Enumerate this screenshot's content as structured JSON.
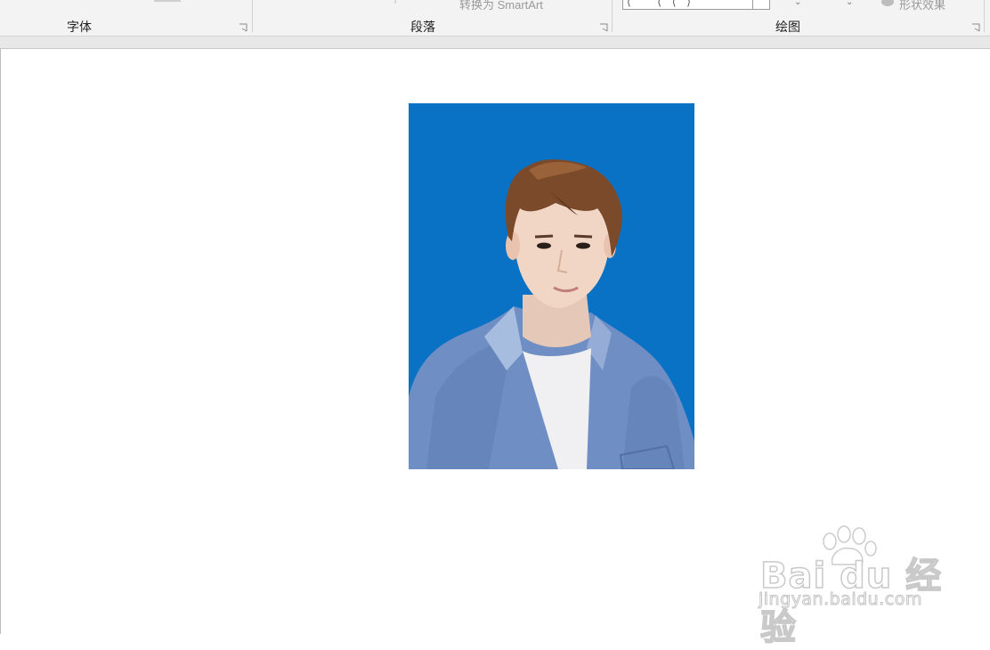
{
  "ribbon": {
    "groups": [
      {
        "label": "字体"
      },
      {
        "label": "段落",
        "ghost_command": "转换为 SmartArt"
      },
      {
        "label": "绘图",
        "ghost_command": "形状效果",
        "shape_glyphs": "⟨ ˅ ⟨ ⟨ ⟩"
      }
    ]
  },
  "document": {
    "image_description": "portrait",
    "background_color": "#0972c5"
  },
  "watermark": {
    "brand": "Bai du 经验",
    "url": "jingyan.baidu.com"
  },
  "colors": {
    "ribbon_bg": "#f3f3f3",
    "photo_bg": "#0972c5",
    "shirt": "#6f8fc4"
  }
}
